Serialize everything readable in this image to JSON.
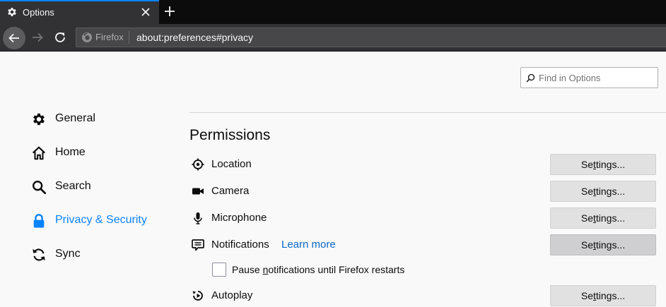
{
  "tab": {
    "title": "Options",
    "icon": "gear-icon"
  },
  "nav": {
    "identity_label": "Firefox",
    "url": "about:preferences#privacy"
  },
  "search": {
    "placeholder": "Find in Options"
  },
  "sidebar": {
    "items": [
      {
        "label": "General",
        "icon": "gear-icon",
        "selected": false
      },
      {
        "label": "Home",
        "icon": "home-icon",
        "selected": false
      },
      {
        "label": "Search",
        "icon": "search-icon",
        "selected": false
      },
      {
        "label": "Privacy & Security",
        "icon": "lock-icon",
        "selected": true
      },
      {
        "label": "Sync",
        "icon": "sync-icon",
        "selected": false
      }
    ]
  },
  "permissions": {
    "title": "Permissions",
    "rows": [
      {
        "label": "Location",
        "icon": "location-icon",
        "button_pre": "Se",
        "button_access": "t",
        "button_post": "tings..."
      },
      {
        "label": "Camera",
        "icon": "camera-icon",
        "button_pre": "Se",
        "button_access": "t",
        "button_post": "tings..."
      },
      {
        "label": "Microphone",
        "icon": "microphone-icon",
        "button_pre": "Se",
        "button_access": "t",
        "button_post": "tings..."
      },
      {
        "label": "Notifications",
        "icon": "notification-icon",
        "link": "Learn more",
        "button_pre": "Se",
        "button_access": "t",
        "button_post": "tings..."
      },
      {
        "label": "Autoplay",
        "icon": "autoplay-icon",
        "button_pre": "Se",
        "button_access": "t",
        "button_post": "tings..."
      }
    ],
    "pause_notifications": {
      "pre": "Pause ",
      "access": "n",
      "post": "otifications until Firefox restarts",
      "checked": false
    }
  },
  "colors": {
    "accent": "#0a84ff",
    "link": "#0a68c8",
    "chrome_dark": "#0c0c0d",
    "toolbar": "#323234",
    "page_bg": "#f9f9fa",
    "button": "#e1e1e2"
  }
}
